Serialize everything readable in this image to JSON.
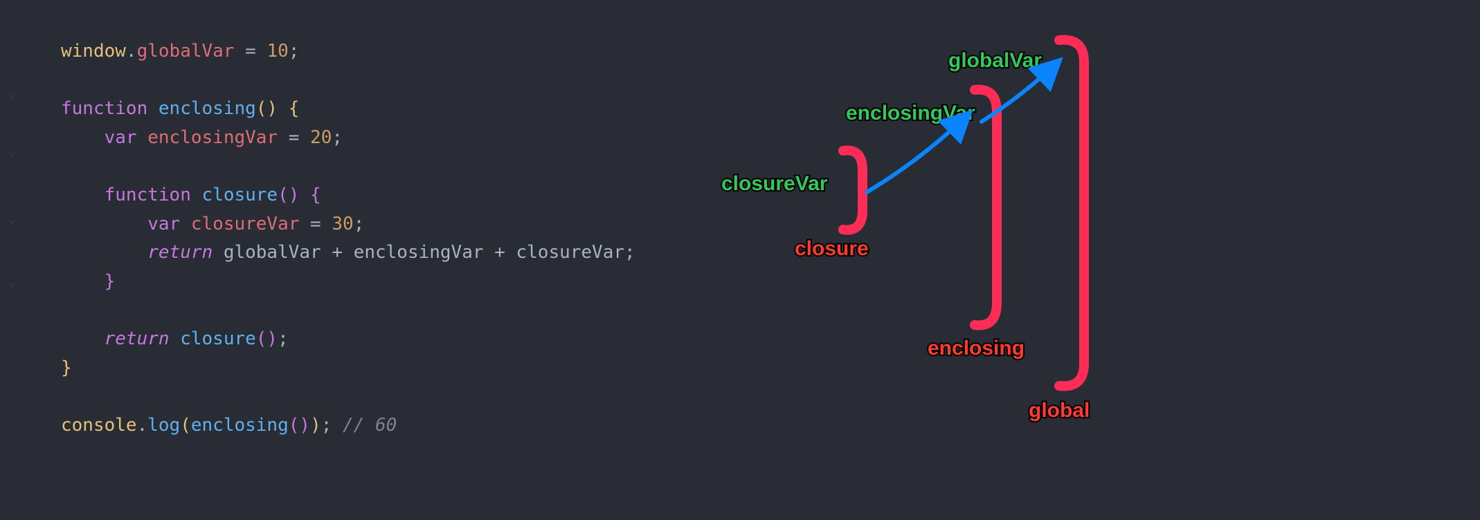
{
  "code": {
    "l1_window": "window",
    "l1_dot": ".",
    "l1_prop": "globalVar",
    "l1_eq": " = ",
    "l1_num": "10",
    "l1_semi": ";",
    "l3_fn_kw": "function",
    "l3_sp": " ",
    "l3_name": "enclosing",
    "l3_paren": "()",
    "l3_open": " {",
    "l4_indent": "    ",
    "l4_var": "var",
    "l4_sp": " ",
    "l4_name": "enclosingVar",
    "l4_eq": " = ",
    "l4_num": "20",
    "l4_semi": ";",
    "l6_indent": "    ",
    "l6_fn_kw": "function",
    "l6_sp": " ",
    "l6_name": "closure",
    "l6_paren": "()",
    "l6_open": " {",
    "l7_indent": "        ",
    "l7_var": "var",
    "l7_sp": " ",
    "l7_name": "closureVar",
    "l7_eq": " = ",
    "l7_num": "30",
    "l7_semi": ";",
    "l8_indent": "        ",
    "l8_ret": "return",
    "l8_sp": " ",
    "l8_a": "globalVar",
    "l8_plus1": " + ",
    "l8_b": "enclosingVar",
    "l8_plus2": " + ",
    "l8_c": "closureVar",
    "l8_semi": ";",
    "l9_indent": "    ",
    "l9_close": "}",
    "l11_indent": "    ",
    "l11_ret": "return",
    "l11_sp": " ",
    "l11_call": "closure",
    "l11_paren": "()",
    "l11_semi": ";",
    "l12_close": "}",
    "l14_console": "console",
    "l14_dot": ".",
    "l14_log": "log",
    "l14_open": "(",
    "l14_call": "enclosing",
    "l14_paren": "()",
    "l14_close": ")",
    "l14_semi": ";",
    "l14_sp": " ",
    "l14_cmt": "// 60"
  },
  "diagram": {
    "scope_labels": {
      "global": "global",
      "enclosing": "enclosing",
      "closure": "closure"
    },
    "var_labels": {
      "globalVar": "globalVar",
      "enclosingVar": "enclosingVar",
      "closureVar": "closureVar"
    },
    "colors": {
      "bracket": "#ff2d55",
      "arrow": "#0a84ff",
      "scope_label": "#ff3b30",
      "var_label": "#34c759"
    }
  }
}
